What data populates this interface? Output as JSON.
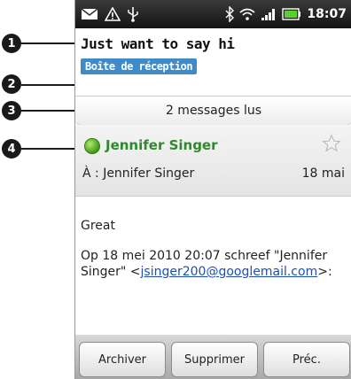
{
  "callouts": [
    "1",
    "2",
    "3",
    "4"
  ],
  "status_bar": {
    "time": "18:07",
    "icons": [
      "mail-icon",
      "warning-icon",
      "usb-icon",
      "bluetooth-icon",
      "wifi-icon",
      "signal-icon",
      "battery-icon"
    ]
  },
  "message": {
    "subject": "Just want to say hi",
    "folder": "Boîte de réception",
    "read_count": "2 messages lus",
    "sender_name": "Jennifer Singer",
    "to_line": "À : Jennifer Singer",
    "date": "18 mai",
    "body_greeting": "Great",
    "quote_prefix": "Op 18 mei 2010 20:07 schreef \"Jennifer Singer\" <",
    "quote_email": "jsinger200@googlemail.com",
    "quote_suffix": ">:"
  },
  "actions": {
    "archive": "Archiver",
    "delete": "Supprimer",
    "previous": "Préc."
  },
  "colors": {
    "accent_blue": "#3f8bc9",
    "sender_green": "#2e8a2c",
    "online_dot": "#5cb82d",
    "link": "#1d4fb5"
  }
}
